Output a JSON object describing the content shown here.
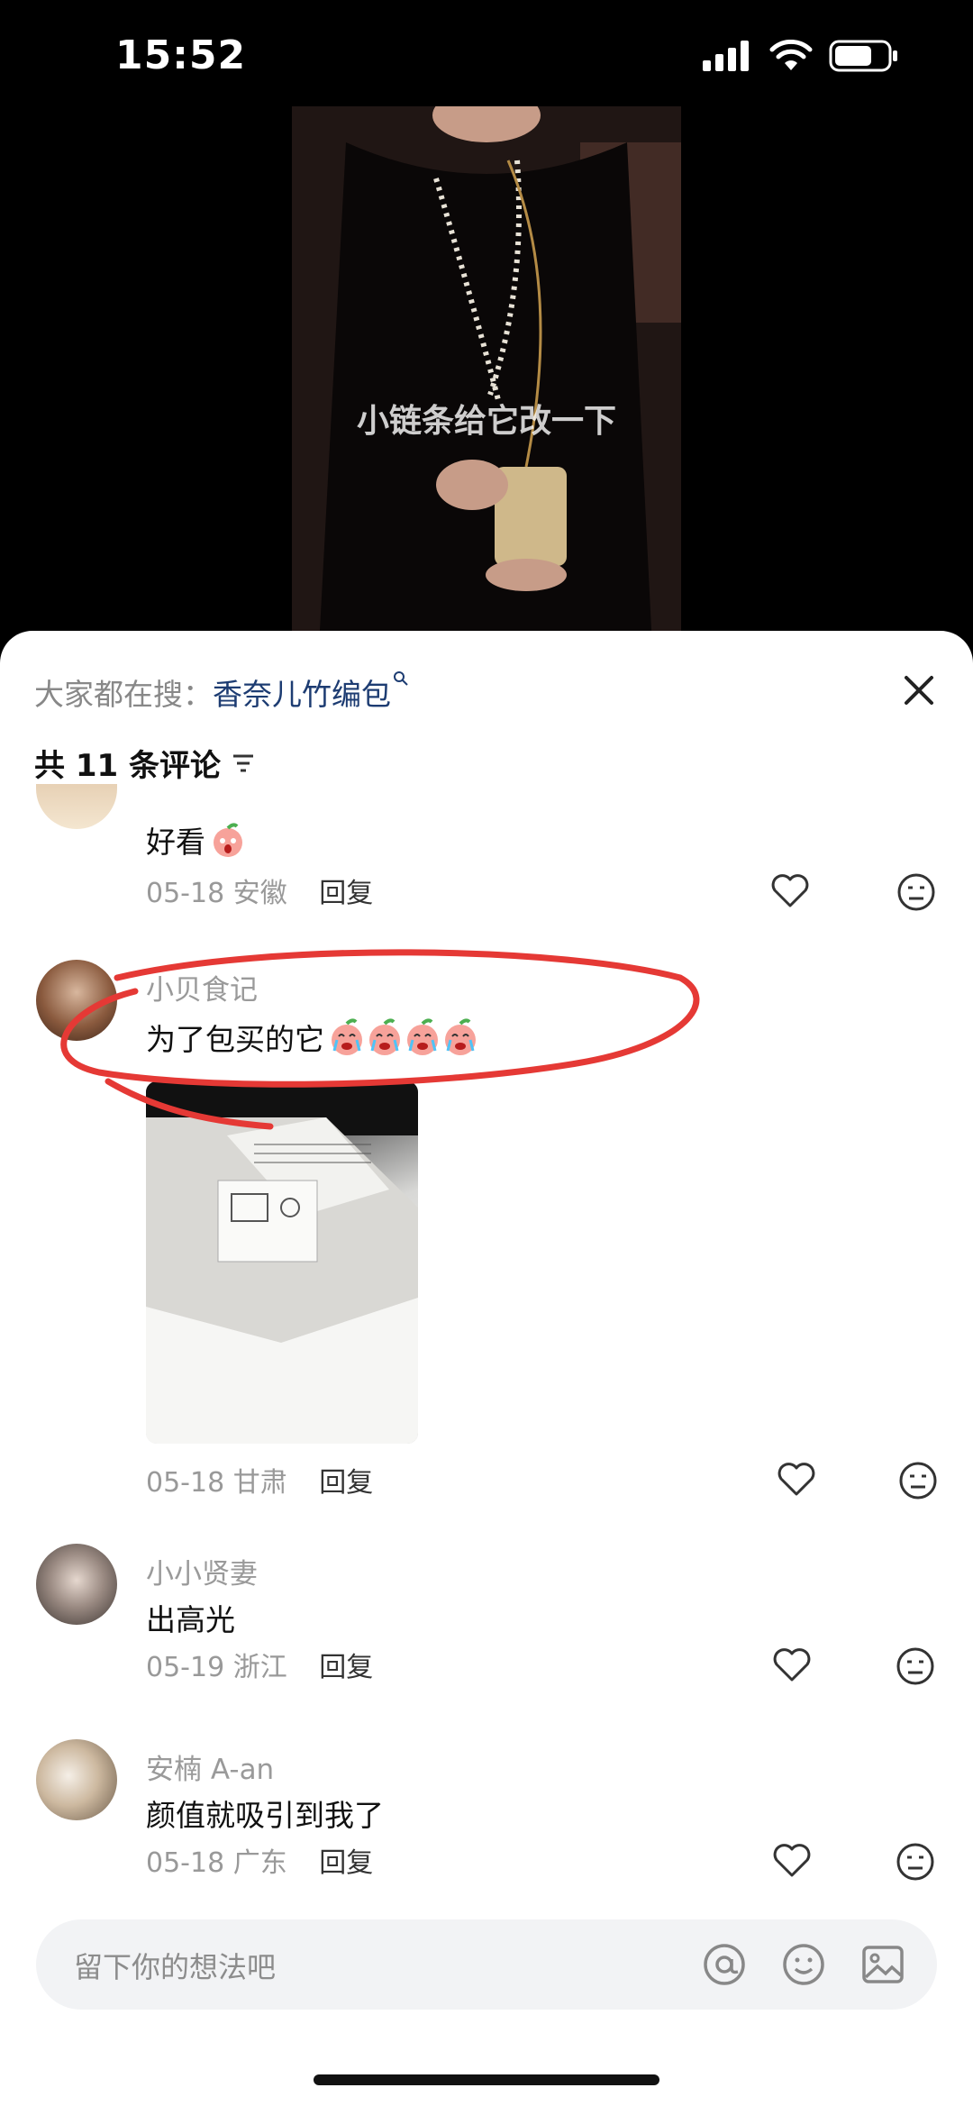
{
  "status": {
    "time": "15:52"
  },
  "video": {
    "caption": "小链条给它改一下"
  },
  "header": {
    "search_prefix": "大家都在搜：",
    "search_keyword": "香奈儿竹编包",
    "comment_count": "共 11 条评论"
  },
  "comments": [
    {
      "text": "好看",
      "date": "05-18",
      "location": "安徽",
      "reply": "回复"
    },
    {
      "username": "小贝食记",
      "text": "为了包买的它",
      "date": "05-18",
      "location": "甘肃",
      "reply": "回复"
    },
    {
      "username": "小小贤妻",
      "text": "出高光",
      "date": "05-19",
      "location": "浙江",
      "reply": "回复"
    },
    {
      "username": "安楠 A-an",
      "text": "颜值就吸引到我了",
      "date": "05-18",
      "location": "广东",
      "reply": "回复"
    }
  ],
  "input": {
    "placeholder": "留下你的想法吧"
  },
  "colors": {
    "keyword": "#1d3c72",
    "annotation": "#e53935"
  },
  "icons": [
    "close-icon",
    "filter-icon",
    "heart-icon",
    "emoji-reaction-icon",
    "at-icon",
    "smiley-icon",
    "image-icon"
  ]
}
